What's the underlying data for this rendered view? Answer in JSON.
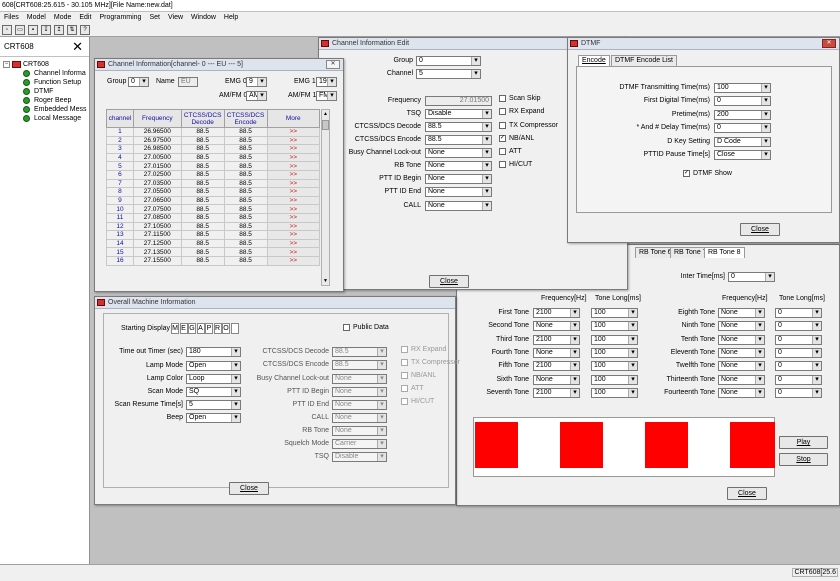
{
  "app": {
    "title": "608[CRT608:25.615 - 30.105 MHz][File Name:new.dat]",
    "status": "CRT608[25.6"
  },
  "menu": [
    "Files",
    "Model",
    "Mode",
    "Edit",
    "Programming",
    "Set",
    "View",
    "Window",
    "Help"
  ],
  "sidebar": {
    "title": "CRT608",
    "root": "CRT608",
    "items": [
      "Channel Informa",
      "Function Setup",
      "DTMF",
      "Roger Beep",
      "Embedded Mess",
      "Local Message"
    ]
  },
  "channel_info": {
    "title": "Channel Information[channel- 0 --- EU --- 5]",
    "group_label": "Group",
    "group_value": "0",
    "name_label": "Name",
    "name_value": "EU",
    "emg0_label": "EMG 0",
    "emg0_value": "9",
    "emg1_label": "EMG 1",
    "emg1_value": "19",
    "amfm0_label": "AM/FM 0",
    "amfm0_value": "AM",
    "amfm1_label": "AM/FM 1",
    "amfm1_value": "FM",
    "headers": [
      "channel",
      "Frequency",
      "CTCSS/DCS Decode",
      "CTCSS/DCS Encode",
      "More"
    ],
    "rows": [
      [
        "1",
        "26.96500",
        "88.5",
        "88.5",
        ">>"
      ],
      [
        "2",
        "26.97500",
        "88.5",
        "88.5",
        ">>"
      ],
      [
        "3",
        "26.98500",
        "88.5",
        "88.5",
        ">>"
      ],
      [
        "4",
        "27.00500",
        "88.5",
        "88.5",
        ">>"
      ],
      [
        "5",
        "27.01500",
        "88.5",
        "88.5",
        ">>"
      ],
      [
        "6",
        "27.02500",
        "88.5",
        "88.5",
        ">>"
      ],
      [
        "7",
        "27.03500",
        "88.5",
        "88.5",
        ">>"
      ],
      [
        "8",
        "27.05500",
        "88.5",
        "88.5",
        ">>"
      ],
      [
        "9",
        "27.06500",
        "88.5",
        "88.5",
        ">>"
      ],
      [
        "10",
        "27.07500",
        "88.5",
        "88.5",
        ">>"
      ],
      [
        "11",
        "27.08500",
        "88.5",
        "88.5",
        ">>"
      ],
      [
        "12",
        "27.10500",
        "88.5",
        "88.5",
        ">>"
      ],
      [
        "13",
        "27.11500",
        "88.5",
        "88.5",
        ">>"
      ],
      [
        "14",
        "27.12500",
        "88.5",
        "88.5",
        ">>"
      ],
      [
        "15",
        "27.13500",
        "88.5",
        "88.5",
        ">>"
      ],
      [
        "16",
        "27.15500",
        "88.5",
        "88.5",
        ">>"
      ]
    ]
  },
  "channel_edit": {
    "title": "Channel Information Edit",
    "group_label": "Group",
    "group_value": "0",
    "channel_label": "Channel",
    "channel_value": "5",
    "frequency_label": "Frequency",
    "frequency_value": "27.01500",
    "tsq_label": "TSQ",
    "tsq_value": "Disable",
    "decode_label": "CTCSS/DCS Decode",
    "decode_value": "88.5",
    "encode_label": "CTCSS/DCS Encode",
    "encode_value": "88.5",
    "bcl_label": "Busy Channel Lock-out",
    "bcl_value": "None",
    "rbtone_label": "RB Tone",
    "rbtone_value": "None",
    "pttb_label": "PTT ID Begin",
    "pttb_value": "None",
    "ptte_label": "PTT ID End",
    "ptte_value": "None",
    "call_label": "CALL",
    "call_value": "None",
    "scan_skip": "Scan Skip",
    "rx_expand": "RX Expand",
    "tx_comp": "TX Compressor",
    "nbanl": "NB/ANL",
    "att": "ATT",
    "hicut": "HI/CUT",
    "close": "Close"
  },
  "dtmf": {
    "title": "DTMF",
    "tabs": [
      "Encode",
      "DTMF Encode List"
    ],
    "tx_time_label": "DTMF Transmitting Time(ms)",
    "tx_time_value": "100",
    "first_label": "First Digital Time(ms)",
    "first_value": "0",
    "pretime_label": "Pretime(ms)",
    "pretime_value": "200",
    "delay_label": "* And # Delay Time(ms)",
    "delay_value": "0",
    "dkey_label": "D Key Setting",
    "dkey_value": "D Code",
    "pause_label": "PTTID Pause Time[s]",
    "pause_value": "Close",
    "show_label": "DTMF Show",
    "close": "Close"
  },
  "rbtone": {
    "tabs": [
      "RB Tone 6",
      "RB Tone 7",
      "RB Tone 8"
    ],
    "inter_label": "Inter Time[ms]",
    "inter_value": "0",
    "freq_header": "Frequency[Hz]",
    "long_header": "Tone Long[ms]",
    "left": [
      {
        "label": "First Tone",
        "freq": "2100",
        "long": "100"
      },
      {
        "label": "Second Tone",
        "freq": "None",
        "long": "100"
      },
      {
        "label": "Third Tone",
        "freq": "2100",
        "long": "100"
      },
      {
        "label": "Fourth Tone",
        "freq": "None",
        "long": "100"
      },
      {
        "label": "Fifth Tone",
        "freq": "2100",
        "long": "100"
      },
      {
        "label": "Sixth Tone",
        "freq": "None",
        "long": "100"
      },
      {
        "label": "Seventh Tone",
        "freq": "2100",
        "long": "100"
      }
    ],
    "right": [
      {
        "label": "Eighth Tone",
        "freq": "None",
        "long": "0"
      },
      {
        "label": "Ninth Tone",
        "freq": "None",
        "long": "0"
      },
      {
        "label": "Tenth Tone",
        "freq": "None",
        "long": "0"
      },
      {
        "label": "Eleventh Tone",
        "freq": "None",
        "long": "0"
      },
      {
        "label": "Twelfth Tone",
        "freq": "None",
        "long": "0"
      },
      {
        "label": "Thirteenth Tone",
        "freq": "None",
        "long": "0"
      },
      {
        "label": "Fourteenth Tone",
        "freq": "None",
        "long": "0"
      }
    ],
    "play": "Play",
    "stop": "Stop",
    "close": "Close",
    "bar_color": "#ff0000"
  },
  "overall": {
    "title": "Overall Machine Information",
    "starting_label": "Starting Display",
    "starting_chars": [
      "M",
      "E",
      "G",
      "A",
      "P",
      "R",
      "O",
      ""
    ],
    "public_label": "Public Data",
    "timeout_label": "Time out Timer (sec)",
    "timeout_value": "180",
    "lamp_mode_label": "Lamp Mode",
    "lamp_mode_value": "Open",
    "lamp_color_label": "Lamp Color",
    "lamp_color_value": "Loop",
    "scan_mode_label": "Scan Mode",
    "scan_mode_value": "SQ",
    "scan_resume_label": "Scan Resume Time[s]",
    "scan_resume_value": "5",
    "beep_label": "Beep",
    "beep_value": "Open",
    "decode_label": "CTCSS/DCS Decode",
    "decode_value": "88.5",
    "encode_label": "CTCSS/DCS Encode",
    "encode_value": "88.5",
    "bcl_label": "Busy Channel Lock-out",
    "bcl_value": "None",
    "pttb_label": "PTT ID Begin",
    "pttb_value": "None",
    "ptte_label": "PTT ID End",
    "ptte_value": "None",
    "call_label": "CALL",
    "call_value": "None",
    "rbtone_label": "RB Tone",
    "rbtone_value": "None",
    "squelch_label": "Squelch Mode",
    "squelch_value": "Carrier",
    "tsq_label": "TSQ",
    "tsq_value": "Disable",
    "rx_expand": "RX Expand",
    "tx_comp": "TX Compressor",
    "nbanl": "NB/ANL",
    "att": "ATT",
    "hicut": "HI/CUT",
    "close": "Close"
  }
}
